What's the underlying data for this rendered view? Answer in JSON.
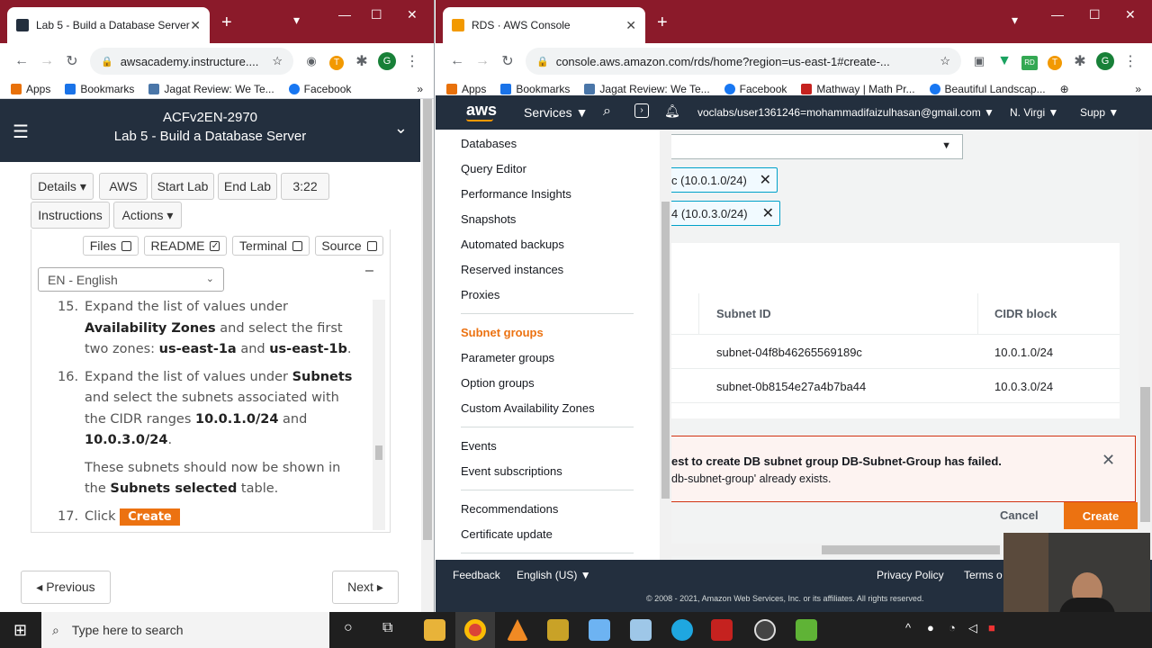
{
  "left_browser": {
    "tab_title": "Lab 5 - Build a Database Server",
    "url": "awsacademy.instructure....",
    "bookmarks": [
      "Apps",
      "Bookmarks",
      "Jagat Review: We Te...",
      "Facebook"
    ],
    "lab_id": "ACFv2EN-2970",
    "lab_title": "Lab 5 - Build a Database Server",
    "buttons": {
      "details": "Details ▾",
      "aws": "AWS",
      "start_lab": "Start Lab",
      "end_lab": "End Lab",
      "timer": "3:22",
      "instructions": "Instructions",
      "actions": "Actions ▾"
    },
    "checks": {
      "files": "Files",
      "readme": "README",
      "terminal": "Terminal",
      "source": "Source"
    },
    "language": "EN - English",
    "minimize": "–",
    "steps": {
      "s15_num": "15.",
      "s15_a": "Expand the list of values under",
      "s15_b": "Availability Zones",
      "s15_c": " and select the first",
      "s15_d": "two zones: ",
      "s15_e": "us-east-1a",
      "s15_f": " and ",
      "s15_g": "us-east-1b",
      "s16_num": "16.",
      "s16_a": "Expand the list of values under ",
      "s16_b": "Subnets",
      "s16_c": "and select the subnets associated with",
      "s16_d": "the CIDR ranges ",
      "s16_e": "10.0.1.0/24",
      "s16_f": " and",
      "s16_g": "10.0.3.0/24",
      "note_a": "These subnets should now be shown in",
      "note_b": "the ",
      "note_c": "Subnets selected",
      "note_d": " table.",
      "s17_num": "17.",
      "s17_a": "Click ",
      "s17_btn": "Create"
    },
    "pager": {
      "prev": "◂ Previous",
      "next": "Next ▸"
    }
  },
  "right_browser": {
    "tab_title": "RDS · AWS Console",
    "url": "console.aws.amazon.com/rds/home?region=us-east-1#create-...",
    "bookmarks": [
      "Apps",
      "Bookmarks",
      "Jagat Review: We Te...",
      "Facebook",
      "Mathway | Math Pr...",
      "Beautiful Landscap..."
    ],
    "aws_nav": {
      "logo": "aws",
      "services": "Services ▼",
      "account": "voclabs/user1361246=mohammadifaizulhasan@gmail.com ▼",
      "region": "N. Virgi ▼",
      "support": "Supp ▼"
    },
    "sidebar": {
      "group1": [
        "Databases",
        "Query Editor",
        "Performance Insights",
        "Snapshots",
        "Automated backups",
        "Reserved instances",
        "Proxies"
      ],
      "group2": [
        "Subnet groups",
        "Parameter groups",
        "Option groups",
        "Custom Availability Zones"
      ],
      "group3": [
        "Events",
        "Event subscriptions"
      ],
      "group4": [
        "Recommendations",
        "Certificate update"
      ]
    },
    "tokens": [
      "c (10.0.1.0/24)",
      "4 (10.0.3.0/24)"
    ],
    "table": {
      "headers": [
        "Subnet ID",
        "CIDR block"
      ],
      "rows": [
        [
          "subnet-04f8b46265569189c",
          "10.0.1.0/24"
        ],
        [
          "subnet-0b8154e27a4b7ba44",
          "10.0.3.0/24"
        ]
      ]
    },
    "error": {
      "title": "est to create DB subnet group DB-Subnet-Group has failed.",
      "detail": "db-subnet-group' already exists."
    },
    "actions": {
      "cancel": "Cancel",
      "create": "Create"
    },
    "footer": {
      "feedback": "Feedback",
      "language": "English (US) ▼",
      "privacy": "Privacy Policy",
      "terms": "Terms o",
      "copyright": "© 2008 - 2021, Amazon Web Services, Inc. or its affiliates. All rights reserved."
    }
  },
  "taskbar": {
    "search_placeholder": "Type here to search"
  },
  "colors": {
    "aws_orange": "#ec7211",
    "aws_dark": "#232f3e",
    "chrome_frame": "#8b1a2a",
    "error_bg": "#fdf3f1",
    "error_border": "#d13212"
  }
}
